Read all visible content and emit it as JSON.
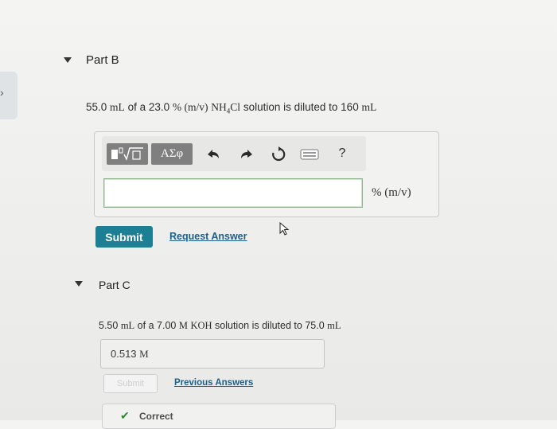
{
  "partB": {
    "title": "Part B",
    "problem": {
      "volume": "55.0",
      "vol_unit": "mL",
      "of_a": "of a",
      "percent": "23.0",
      "pct_unit": "% (m/v)",
      "compound_pre": "NH",
      "compound_sub": "4",
      "compound_post": "Cl",
      "diluted": "solution is diluted to",
      "final_vol": "160",
      "final_unit": "mL"
    },
    "toolbar": {
      "greek_label": "ΑΣφ",
      "help_label": "?"
    },
    "input_value": "",
    "unit_label": "% (m/v)",
    "submit_label": "Submit",
    "request_answer_label": "Request Answer"
  },
  "partC": {
    "title": "Part C",
    "problem": {
      "volume": "5.50",
      "vol_unit": "mL",
      "of_a": "of a",
      "molarity": "7.00",
      "mol_unit": "M",
      "compound": "KOH",
      "diluted": "solution is diluted to",
      "final_vol": "75.0",
      "final_unit": "mL"
    },
    "answer_value": "0.513",
    "answer_unit": "M",
    "submit_label": "Submit",
    "previous_answers_label": "Previous Answers",
    "correct_label": "Correct"
  }
}
